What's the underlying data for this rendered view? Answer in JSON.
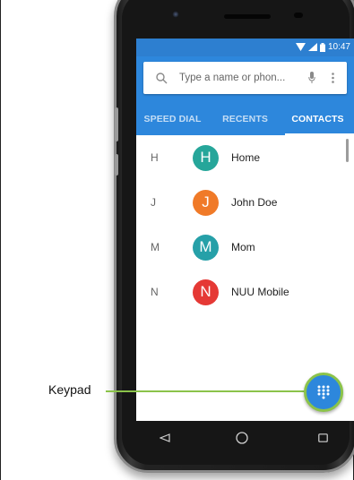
{
  "status_bar": {
    "time": "10:47",
    "icons": [
      "wifi-icon",
      "signal-icon",
      "battery-icon"
    ]
  },
  "search": {
    "placeholder": "Type a name or phon..."
  },
  "tabs": [
    {
      "label": "SPEED DIAL",
      "active": false
    },
    {
      "label": "RECENTS",
      "active": false
    },
    {
      "label": "CONTACTS",
      "active": true
    }
  ],
  "contacts": [
    {
      "letter": "H",
      "initial": "H",
      "name": "Home",
      "color": "#26a69a"
    },
    {
      "letter": "J",
      "initial": "J",
      "name": "John Doe",
      "color": "#f07a28"
    },
    {
      "letter": "M",
      "initial": "M",
      "name": "Mom",
      "color": "#26a0a8"
    },
    {
      "letter": "N",
      "initial": "N",
      "name": "NUU Mobile",
      "color": "#e53935"
    }
  ],
  "callout": {
    "label": "Keypad"
  },
  "colors": {
    "primary": "#2d87dc",
    "status": "#2d7fd0",
    "highlight": "#8bc34a"
  },
  "nav": [
    "back-icon",
    "home-icon",
    "recents-icon"
  ]
}
